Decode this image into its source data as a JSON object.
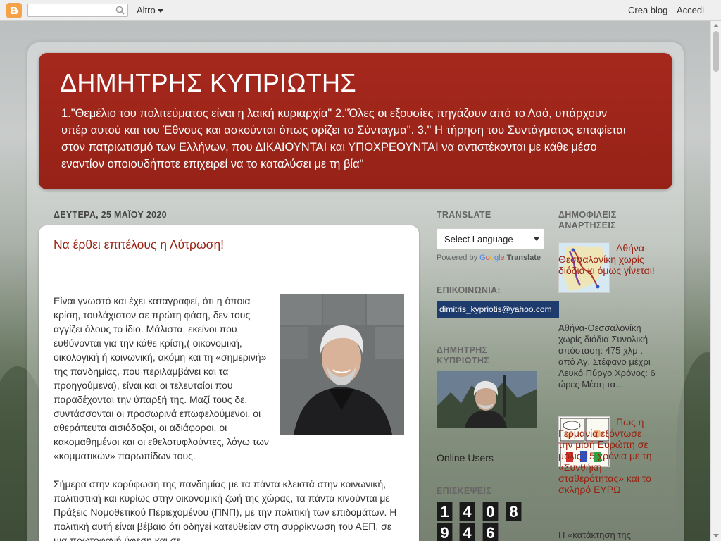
{
  "navbar": {
    "search_placeholder": "",
    "more_label": "Altro",
    "create_blog": "Crea blog",
    "sign_in": "Accedi"
  },
  "header": {
    "title": "ΔΗΜΗΤΡΗΣ ΚΥΠΡΙΩΤΗΣ",
    "description": "1.\"Θεμέλιο του πολιτεύματος είναι η λαική κυριαρχία\" 2.\"Όλες οι εξουσίες πηγάζουν από το Λαό, υπάρχουν υπέρ αυτού και του Έθνους και ασκούνται όπως ορίζει το Σύνταγμα\". 3.\" Η τήρηση του Συντάγματος επαφίεται στον πατριωτισμό των Ελλήνων, που ΔΙΚΑΙΟΥΝΤΑΙ και ΥΠΟΧΡΕΟΥΝΤΑΙ να αντιστέκονται με κάθε μέσο εναντίον οποιουδήποτε επιχειρεί να το καταλύσει με τη βία\""
  },
  "post": {
    "date": "ΔΕΥΤΕΡΑ, 25 ΜΑΪΟΥ 2020",
    "title": "Να έρθει επιτέλους η Λύτρωση!",
    "paragraph1": "Είναι γνωστό και έχει καταγραφεί, ότι η όποια κρίση, τουλάχιστον σε πρώτη φάση, δεν τους αγγίζει όλους το ίδιο. Μάλιστα,  εκείνοι που ευθύνονται για την κάθε κρίση,( οικονομική, οικολογική ή κοινωνική, ακόμη και τη «σημερινή» της  πανδημίας, που περιλαμβάνει και τα προηγούμενα), είναι και οι τελευταίοι που παραδέχονται την ύπαρξή της. Μαζί τους δε, συντάσσονται οι προσωρινά επωφελούμενοι, οι αθεράπευτα αισιόδοξοι, οι αδιάφοροι, οι κακομαθημένοι και οι εθελοτυφλούντες, λόγω των «κομματικών» παρωπίδων τους.",
    "paragraph2": "Σήμερα στην κορύφωση της πανδημίας με τα πάντα κλειστά στην κοινωνική, πολιτιστική και κυρίως στην οικονομική ζωή της χώρας, τα πάντα κινούνται με Πράξεις Νομοθετικού Περιεχομένου (ΠΝΠ), με την πολιτική των επιδομάτων. Η  πολιτική αυτή είναι βέβαιο ότι οδηγεί κατευθείαν στη συρρίκνωση του ΑΕΠ, σε μια πρωτοφανή ύφεση και σε"
  },
  "sidebar": {
    "translate_title": "TRANSLATE",
    "select_language": "Select Language",
    "powered_by": "Powered by",
    "google": [
      "G",
      "o",
      "o",
      "g",
      "l",
      "e"
    ],
    "translate_word": "Translate",
    "contact_title": "ΕΠΙΚΟΙΝΩΝΙΑ:",
    "email": "dimitris_kypriotis@yahoo.com",
    "profile_title": "ΔΗΜΗΤΡΗΣ ΚΥΠΡΙΩΤΗΣ",
    "online_users": "Online Users",
    "visits_title": "ΕΠΙΣΚΕΨΕΙΣ",
    "counter_row1": [
      "1",
      "4",
      "0",
      "8"
    ],
    "counter_row2": [
      "9",
      "4",
      "6"
    ]
  },
  "popular": {
    "title": "ΔΗΜΟΦΙΛΕΙΣ ΑΝΑΡΤΗΣΕΙΣ",
    "post1_title": "Αθήνα-Θεσσαλονίκη χωρίς διόδια κι όμως γίνεται!",
    "post1_snippet": "Αθήνα-Θεσσαλονίκη χωρίς διόδια Συνολική απόσταση: 475 χλμ . από Αγ. Στέφανο μέχρι Λευκό Πύργο Χρόνος: 6 ώρες Μέση τα...",
    "post2_title": "Πως η Γερμανία εξόντωσε την μισή Ευρώπη σε μόλις 15 χρόνια με τη «Συνθήκη σταθερότητας» και το σκληρό ΕΥΡΩ",
    "post2_snippet": "Η «κατάκτηση της"
  }
}
